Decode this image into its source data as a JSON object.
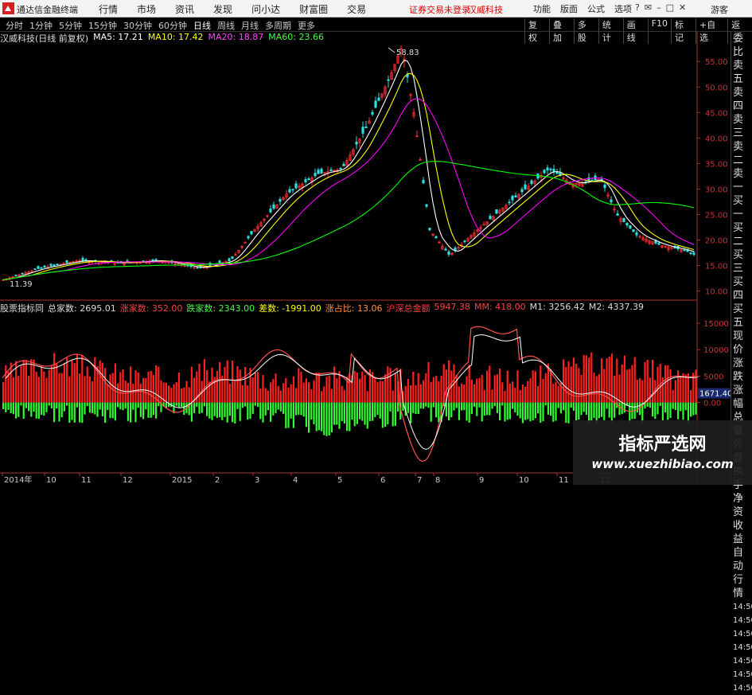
{
  "titlebar": {
    "app_title": "通达信金融终端",
    "menu": [
      "行情",
      "市场",
      "资讯",
      "发现",
      "问小达",
      "财富圈",
      "交易"
    ],
    "notice": "证券交易未登录",
    "stock_name": "汉威科技",
    "right_menu": [
      "功能",
      "版面",
      "公式",
      "选项"
    ],
    "guest": "游客"
  },
  "toolbar": {
    "periods": [
      "分时",
      "1分钟",
      "5分钟",
      "15分钟",
      "30分钟",
      "60分钟",
      "日线",
      "周线",
      "月线",
      "多周期",
      "更多"
    ],
    "active_period": "日线",
    "tools": [
      "复权",
      "叠加",
      "多股",
      "统计",
      "画线",
      "F10",
      "标记",
      "+自选",
      "返回"
    ]
  },
  "kline": {
    "label": "汉威科技(日线 前复权)",
    "ma5": "MA5: 17.21",
    "ma10": "MA10: 17.42",
    "ma20": "MA20: 18.87",
    "ma60": "MA60: 23.66",
    "high_mark": "58.83",
    "low_mark": "11.39",
    "y_ticks": [
      "55.00",
      "50.00",
      "45.00",
      "40.00",
      "35.00",
      "30.00",
      "25.00",
      "20.00",
      "15.00",
      "10.00"
    ],
    "colors": {
      "ma5": "#ffffff",
      "ma10": "#ffff00",
      "ma20": "#ff00ff",
      "ma60": "#00ff00"
    }
  },
  "indicator": {
    "label": "股票指标同",
    "total": "总家数: 2695.01",
    "up": "涨家数: 352.00",
    "down": "跌家数: 2343.00",
    "diff": "差数: -1991.00",
    "ratio": "涨占比: 13.06",
    "market": "沪深总金额",
    "amount": "5947.38",
    "mm": "MM: 418.00",
    "m1": "M1: 3256.42",
    "m2": "M2: 4337.39",
    "y_ticks": [
      "15000",
      "10000",
      "5000",
      "0.00"
    ],
    "current_value": "1671.40"
  },
  "right_panel": [
    "委比",
    "卖五",
    "卖四",
    "卖三",
    "卖二",
    "卖一",
    "买一",
    "买二",
    "买三",
    "买四",
    "买五",
    "现价",
    "涨跌",
    "涨幅",
    "总量",
    "外盘",
    "换手",
    "净资",
    "收益",
    "自动",
    "行情",
    "14:50",
    "14:50",
    "14:50",
    "14:50",
    "14:50",
    "14:50",
    "14:50"
  ],
  "x_axis": [
    "2014年",
    "10",
    "11",
    "12",
    "2015",
    "2",
    "3",
    "4",
    "5",
    "6",
    "7",
    "8",
    "9",
    "10",
    "11",
    "12"
  ],
  "watermark": {
    "title": "指标严选网",
    "url": "www.xuezhibiao.com"
  }
}
